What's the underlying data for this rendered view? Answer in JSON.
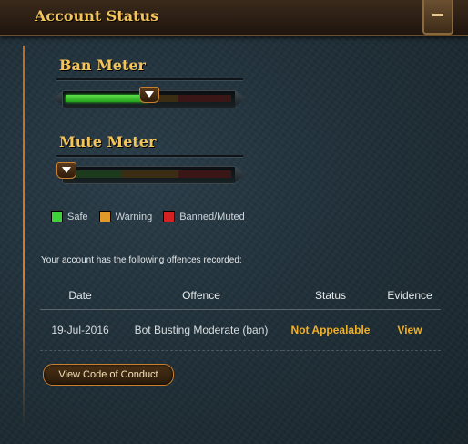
{
  "header": {
    "title": "Account Status",
    "collapse_label": "−"
  },
  "ban_meter": {
    "title": "Ban Meter",
    "level": 0.5
  },
  "mute_meter": {
    "title": "Mute Meter",
    "level": 0.0
  },
  "legend": [
    {
      "label": "Safe",
      "color": "#3fd13a"
    },
    {
      "label": "Warning",
      "color": "#e09a2a"
    },
    {
      "label": "Banned/Muted",
      "color": "#d42222"
    }
  ],
  "offences": {
    "intro": "Your account has the following offences recorded:",
    "columns": [
      "Date",
      "Offence",
      "Status",
      "Evidence"
    ],
    "rows": [
      {
        "date": "19-Jul-2016",
        "offence": "Bot Busting Moderate (ban)",
        "status": "Not Appealable",
        "evidence": "View"
      }
    ]
  },
  "conduct_button": {
    "label": "View Code of Conduct"
  },
  "colors": {
    "accent": "#f0b02a",
    "title": "#f2c45a"
  }
}
